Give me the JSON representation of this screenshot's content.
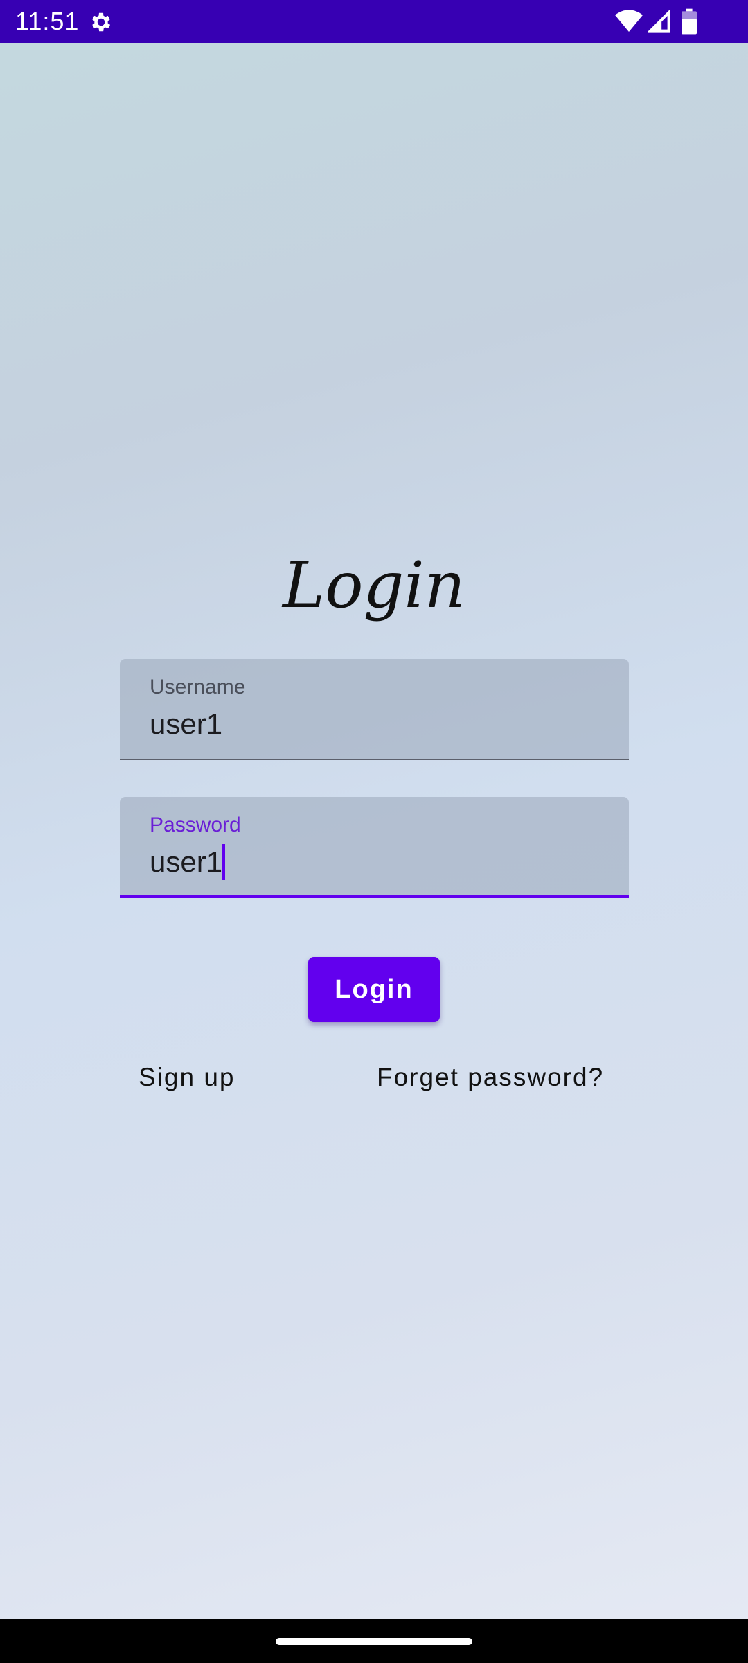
{
  "status_bar": {
    "time": "11:51",
    "icons": [
      "gear-icon",
      "wifi-icon",
      "signal-icon",
      "battery-icon"
    ],
    "background_color": "#3700b3"
  },
  "login": {
    "title": "Login",
    "username": {
      "label": "Username",
      "value": "user1"
    },
    "password": {
      "label": "Password",
      "value": "user1",
      "focused": true
    },
    "login_button_label": "Login",
    "signup_link": "Sign up",
    "forget_password_link": "Forget password?",
    "accent_color": "#6200ee"
  }
}
